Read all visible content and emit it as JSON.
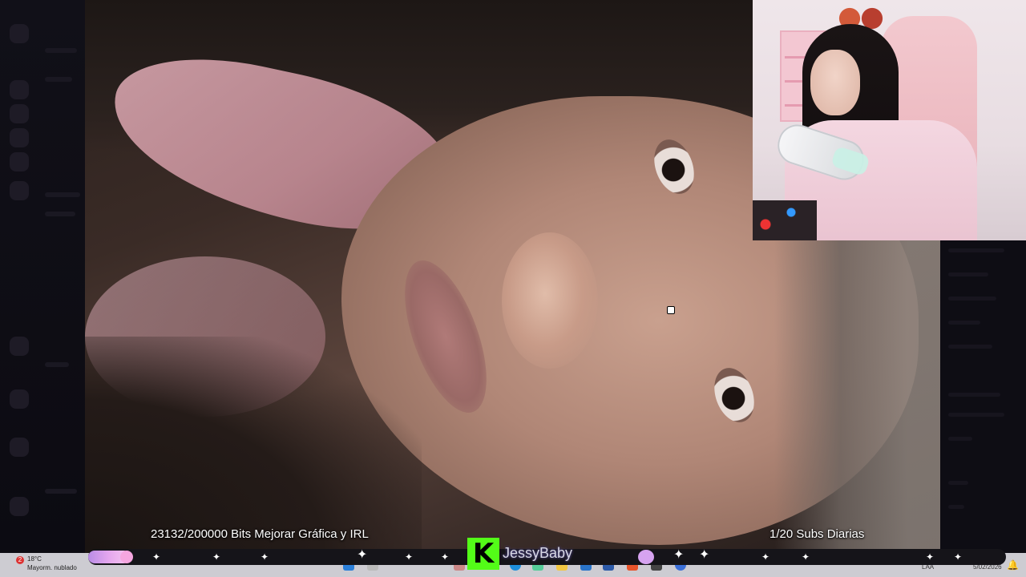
{
  "stream_overlay": {
    "bits_goal_text": "23132/200000 Bits Mejorar Gráfica y IRL",
    "subs_goal_text": "1/20 Subs Diarias",
    "channel_name": "JessyBaby",
    "platform_logo_letter": "K",
    "platform_color": "#53fc18"
  },
  "taskbar": {
    "weather_badge": "2",
    "weather_temp": "18°C",
    "weather_condition": "Mayorm. nublado",
    "language": "LAA",
    "date": "5/02/2026",
    "icons": [
      "windows-start-icon",
      "search-icon",
      "edge-icon",
      "store-icon",
      "folder-icon",
      "vscode-icon",
      "app-icon",
      "brave-icon",
      "app-icon",
      "chrome-icon"
    ]
  }
}
